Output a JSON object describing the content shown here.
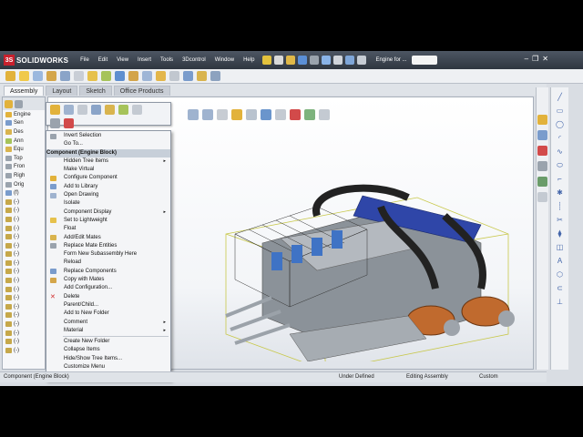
{
  "app": {
    "brand_prefix": "3S",
    "brand_name": "SOLIDWORKS",
    "doc_title": "Engine for ..."
  },
  "menubar": [
    "File",
    "Edit",
    "View",
    "Insert",
    "Tools",
    "3Dcontrol",
    "Window",
    "Help"
  ],
  "tabs": [
    {
      "label": "Assembly",
      "active": true
    },
    {
      "label": "Layout",
      "active": false
    },
    {
      "label": "Sketch",
      "active": false
    },
    {
      "label": "Office Products",
      "active": false
    }
  ],
  "tree": {
    "items": [
      "Engine",
      "Sen",
      "Des",
      "Ann",
      "Equ",
      "Top",
      "Fron",
      "Righ",
      "Orig",
      "(f)",
      "(-)",
      "(-)",
      "(-)",
      "(-)",
      "(-)",
      "(-)",
      "(-)",
      "(-)",
      "(-)",
      "(-)",
      "(-)",
      "(-)",
      "(-)",
      "(-)",
      "(-)",
      "(-)",
      "(-)",
      "(-)"
    ]
  },
  "context_menu": {
    "items": [
      {
        "label": "Invert Selection",
        "icon": "invert-selection-icon"
      },
      {
        "label": "Go To...",
        "icon": ""
      },
      {
        "label": "Component (Engine Block)",
        "header": true
      },
      {
        "label": "Hidden Tree Items",
        "arrow": true
      },
      {
        "label": "Make Virtual",
        "icon": ""
      },
      {
        "label": "Configure Component",
        "icon": "configure-icon"
      },
      {
        "label": "Add to Library",
        "icon": "library-icon"
      },
      {
        "label": "Open Drawing",
        "icon": "drawing-icon"
      },
      {
        "label": "Isolate",
        "icon": ""
      },
      {
        "label": "Component Display",
        "arrow": true
      },
      {
        "label": "Set to Lightweight",
        "icon": "lightweight-icon"
      },
      {
        "label": "Float",
        "icon": ""
      },
      {
        "label": "Add/Edit Mates",
        "icon": "mates-icon"
      },
      {
        "label": "Replace Mate Entities",
        "icon": "replace-mate-icon"
      },
      {
        "label": "Form New Subassembly Here",
        "icon": ""
      },
      {
        "label": "Reload",
        "icon": ""
      },
      {
        "label": "Replace Components",
        "icon": "replace-components-icon"
      },
      {
        "label": "Copy with Mates",
        "icon": "copy-mates-icon"
      },
      {
        "label": "Add Configuration...",
        "icon": ""
      },
      {
        "label": "Delete",
        "icon": "delete-icon"
      },
      {
        "label": "Parent/Child...",
        "icon": ""
      },
      {
        "label": "Add to New Folder",
        "icon": ""
      },
      {
        "label": "Comment",
        "arrow": true
      },
      {
        "label": "Material",
        "arrow": true,
        "sep_after": true
      },
      {
        "label": "Create New Folder",
        "icon": ""
      },
      {
        "label": "Collapse Items",
        "icon": ""
      },
      {
        "label": "Hide/Show Tree Items...",
        "icon": ""
      },
      {
        "label": "Customize Menu",
        "icon": ""
      }
    ]
  },
  "status": {
    "defined": "Under Defined",
    "mode": "Editing Assembly",
    "units": "Custom"
  },
  "colors": {
    "titlebar": "#2f3640",
    "accent": "#c8202d",
    "highlight": "#c7cfd9"
  }
}
